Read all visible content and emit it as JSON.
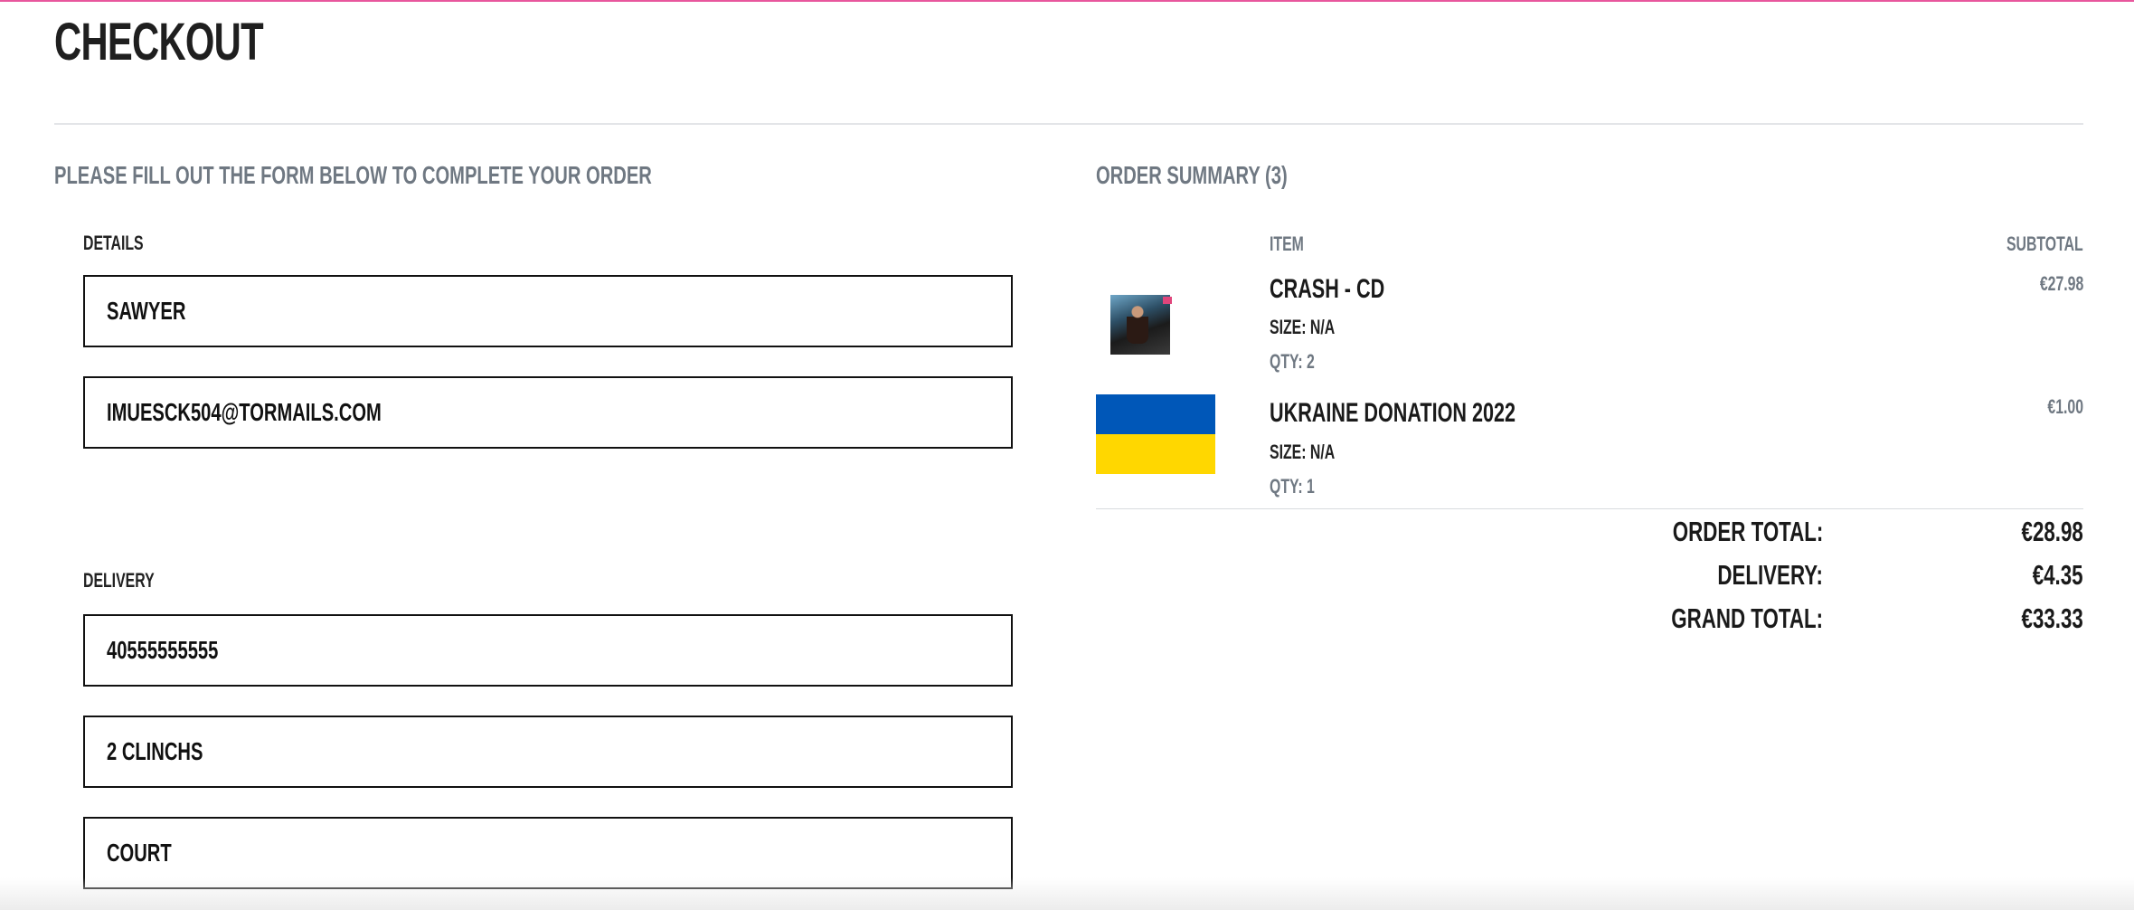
{
  "colors": {
    "accent": "#e8579d",
    "ukraine_blue": "#0057b8",
    "ukraine_yellow": "#ffd700",
    "muted_text": "#6f7882"
  },
  "page": {
    "title": "CHECKOUT"
  },
  "form": {
    "heading": "PLEASE FILL OUT THE FORM BELOW TO COMPLETE YOUR ORDER",
    "details_label": "DETAILS",
    "details_fields": [
      {
        "value": "SAWYER"
      },
      {
        "value": "IMUESCK504@TORMAILS.COM"
      }
    ],
    "delivery_label": "DELIVERY",
    "delivery_fields": [
      {
        "value": "40555555555"
      },
      {
        "value": "2 CLINCHS"
      },
      {
        "value": "COURT"
      }
    ]
  },
  "summary": {
    "heading": "ORDER SUMMARY (3)",
    "columns": {
      "item": "ITEM",
      "subtotal": "SUBTOTAL"
    },
    "items": [
      {
        "name": "CRASH - CD",
        "size": "SIZE: N/A",
        "qty": "QTY: 2",
        "price": "€27.98",
        "thumbnail": "album-cd-image"
      },
      {
        "name": "UKRAINE DONATION 2022",
        "size": "SIZE: N/A",
        "qty": "QTY: 1",
        "price": "€1.00",
        "thumbnail": "ukraine-flag-image"
      }
    ],
    "totals": [
      {
        "label": "ORDER TOTAL:",
        "value": "€28.98"
      },
      {
        "label": "DELIVERY:",
        "value": "€4.35"
      },
      {
        "label": "GRAND TOTAL:",
        "value": "€33.33"
      }
    ]
  }
}
